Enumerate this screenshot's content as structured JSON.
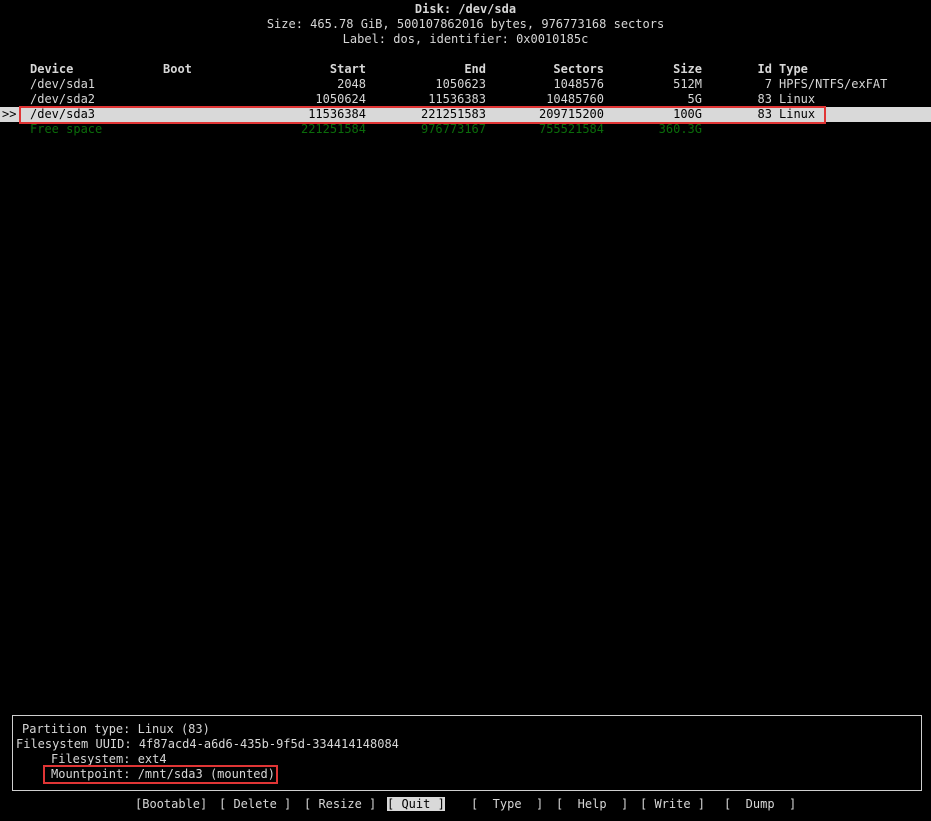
{
  "disk": {
    "title": "Disk: /dev/sda",
    "size_line": "Size: 465.78 GiB, 500107862016 bytes, 976773168 sectors",
    "label_line": "Label: dos, identifier: 0x0010185c"
  },
  "table": {
    "headers": {
      "device": "Device",
      "boot": "Boot",
      "start": "Start",
      "end": "End",
      "sectors": "Sectors",
      "size": "Size",
      "id": "Id",
      "type": "Type"
    },
    "cursor": ">>",
    "rows": [
      {
        "device": "/dev/sda1",
        "boot": "",
        "start": "2048",
        "end": "1050623",
        "sectors": "1048576",
        "size": "512M",
        "id": "7",
        "type": "HPFS/NTFS/exFAT"
      },
      {
        "device": "/dev/sda2",
        "boot": "",
        "start": "1050624",
        "end": "11536383",
        "sectors": "10485760",
        "size": "5G",
        "id": "83",
        "type": "Linux"
      },
      {
        "device": "/dev/sda3",
        "boot": "",
        "start": "11536384",
        "end": "221251583",
        "sectors": "209715200",
        "size": "100G",
        "id": "83",
        "type": "Linux"
      },
      {
        "device": "Free space",
        "boot": "",
        "start": "221251584",
        "end": "976773167",
        "sectors": "755521584",
        "size": "360.3G",
        "id": "",
        "type": ""
      }
    ]
  },
  "info": {
    "partition_type": "Partition type: Linux (83)",
    "uuid": "Filesystem UUID: 4f87acd4-a6d6-435b-9f5d-334414148084",
    "filesystem": "Filesystem: ext4",
    "mountpoint": "Mountpoint: /mnt/sda3 (mounted)"
  },
  "menu": {
    "bootable": "[Bootable]",
    "delete_open": "[ Delete ]",
    "resize": "[ Resize ]",
    "quit_lbr": "[",
    "quit": " Quit ",
    "quit_rbr": "]",
    "type": "[  Type  ]",
    "help": "[  Help  ]",
    "write": "[ Write ]",
    "dump": "[  Dump  ]"
  },
  "colors": {
    "highlight_box": "#e03535",
    "free_space": "#0a6b0a",
    "selected_bg": "#d9d9d9"
  }
}
